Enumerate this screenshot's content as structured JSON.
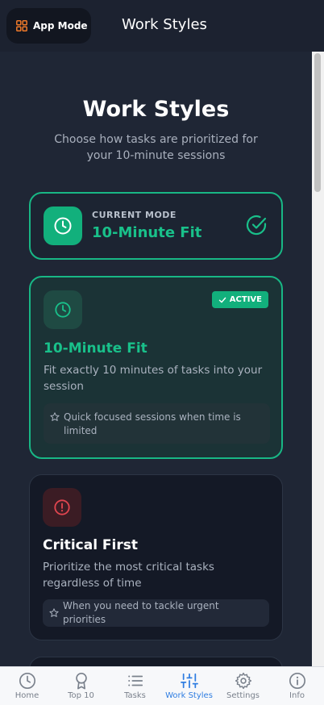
{
  "header": {
    "app_mode_label": "App Mode",
    "title": "Work Styles"
  },
  "page": {
    "title": "Work Styles",
    "subtitle": "Choose how tasks are prioritized for your 10-minute sessions"
  },
  "current_mode": {
    "label": "CURRENT MODE",
    "value": "10-Minute Fit"
  },
  "styles": [
    {
      "title": "10-Minute Fit",
      "description": "Fit exactly 10 minutes of tasks into your session",
      "tip": "Quick focused sessions when time is limited",
      "badge": "ACTIVE",
      "icon": "clock-icon"
    },
    {
      "title": "Critical First",
      "description": "Prioritize the most critical tasks regardless of time",
      "tip": "When you need to tackle urgent priorities",
      "icon": "alert-circle-icon"
    }
  ],
  "nav": [
    {
      "label": "Home",
      "icon": "clock-icon"
    },
    {
      "label": "Top 10",
      "icon": "award-icon"
    },
    {
      "label": "Tasks",
      "icon": "list-icon"
    },
    {
      "label": "Work Styles",
      "icon": "sliders-icon",
      "active": true
    },
    {
      "label": "Settings",
      "icon": "gear-icon"
    },
    {
      "label": "Info",
      "icon": "info-icon"
    }
  ],
  "colors": {
    "accent_green": "#19c08a",
    "critical_red": "#e0454f",
    "nav_active": "#2f7de1",
    "app_mode_icon": "#f07a2a"
  }
}
